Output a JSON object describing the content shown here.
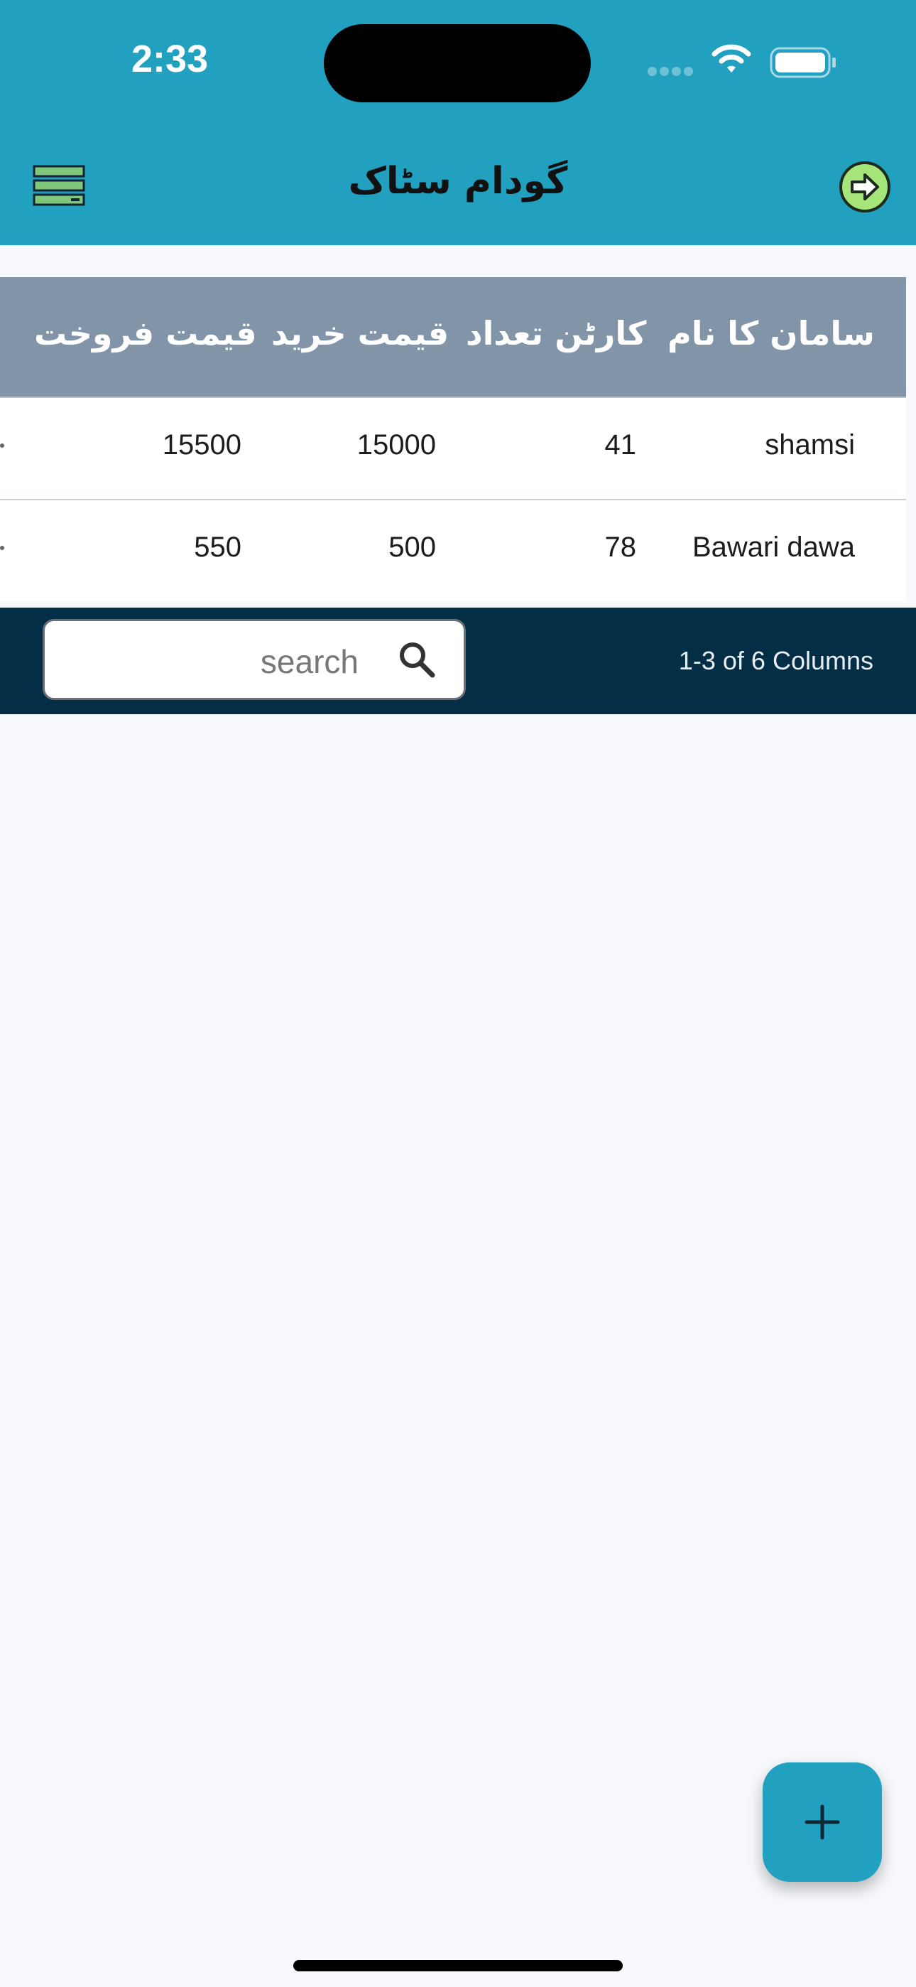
{
  "status_bar": {
    "time": "2:33"
  },
  "header": {
    "title": "گودام سٹاک",
    "menu_icon": "menu-list-icon",
    "logout_icon": "logout-arrow-icon"
  },
  "table": {
    "columns": [
      "سامان کا نام",
      "کارٹن تعداد",
      "قیمت خرید",
      "قیمت فروخت"
    ],
    "rows": [
      {
        "name": "shamsi",
        "cartons": "41",
        "buy_price": "15000",
        "sell_price": "15500"
      },
      {
        "name": "Bawari dawa",
        "cartons": "78",
        "buy_price": "500",
        "sell_price": "550"
      }
    ]
  },
  "footer": {
    "search_placeholder": "search",
    "pagination": "1-3 of 6 Columns"
  },
  "fab": {
    "icon": "plus-icon"
  },
  "colors": {
    "primary": "#22a0c0",
    "header_row": "#8194a8",
    "footer": "#042e45",
    "logout_button": "#a6e57a"
  }
}
